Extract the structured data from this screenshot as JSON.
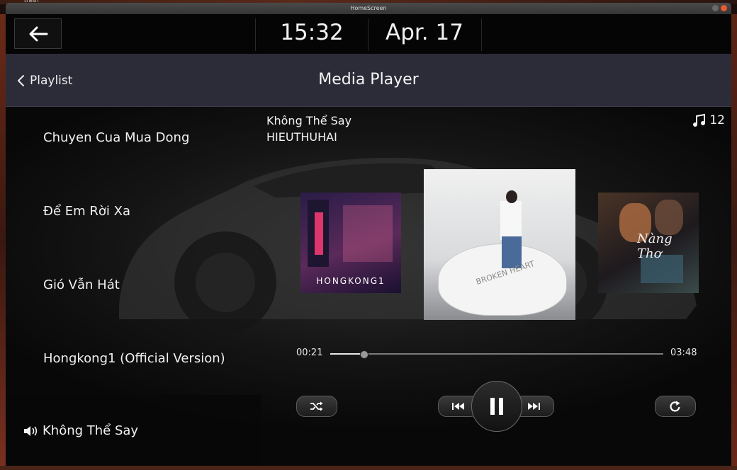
{
  "desktop": {
    "label": "trash"
  },
  "window": {
    "title": "HomeScreen"
  },
  "topbar": {
    "time": "15:32",
    "date": "Apr. 17"
  },
  "header": {
    "back_label": "Playlist",
    "title": "Media Player"
  },
  "playlist": {
    "items": [
      {
        "label": "Chuyen Cua Mua Dong"
      },
      {
        "label": "Để Em Rời Xa"
      },
      {
        "label": "Gió Vẫn Hát"
      },
      {
        "label": "Hongkong1 (Official Version)"
      }
    ],
    "now_playing": "Không Thể Say"
  },
  "track": {
    "title": "Không Thể Say",
    "artist": "HIEUTHUHAI",
    "count": "12"
  },
  "albums": [
    {
      "text": "HONGKONG1",
      "colors": [
        "#1c1436",
        "#3a2450",
        "#ff3c78"
      ]
    },
    {
      "text": "BROKEN HEART",
      "colors": [
        "#e8e8e8",
        "#bfc2c6",
        "#f2f2f2"
      ]
    },
    {
      "text": "Nàng Thơ",
      "colors": [
        "#1a1a1e",
        "#6a4c3a",
        "#d89060"
      ]
    }
  ],
  "progress": {
    "elapsed": "00:21",
    "duration": "03:48",
    "fraction": 0.1
  },
  "controls": {
    "shuffle": "shuffle-icon",
    "previous": "skip-previous-icon",
    "play_state": "pause-icon",
    "next": "skip-next-icon",
    "repeat": "repeat-icon"
  },
  "colors": {
    "header_bg": "#2c2c39",
    "accent_text": "#f2f2f2",
    "track": "#7a7a7a"
  }
}
